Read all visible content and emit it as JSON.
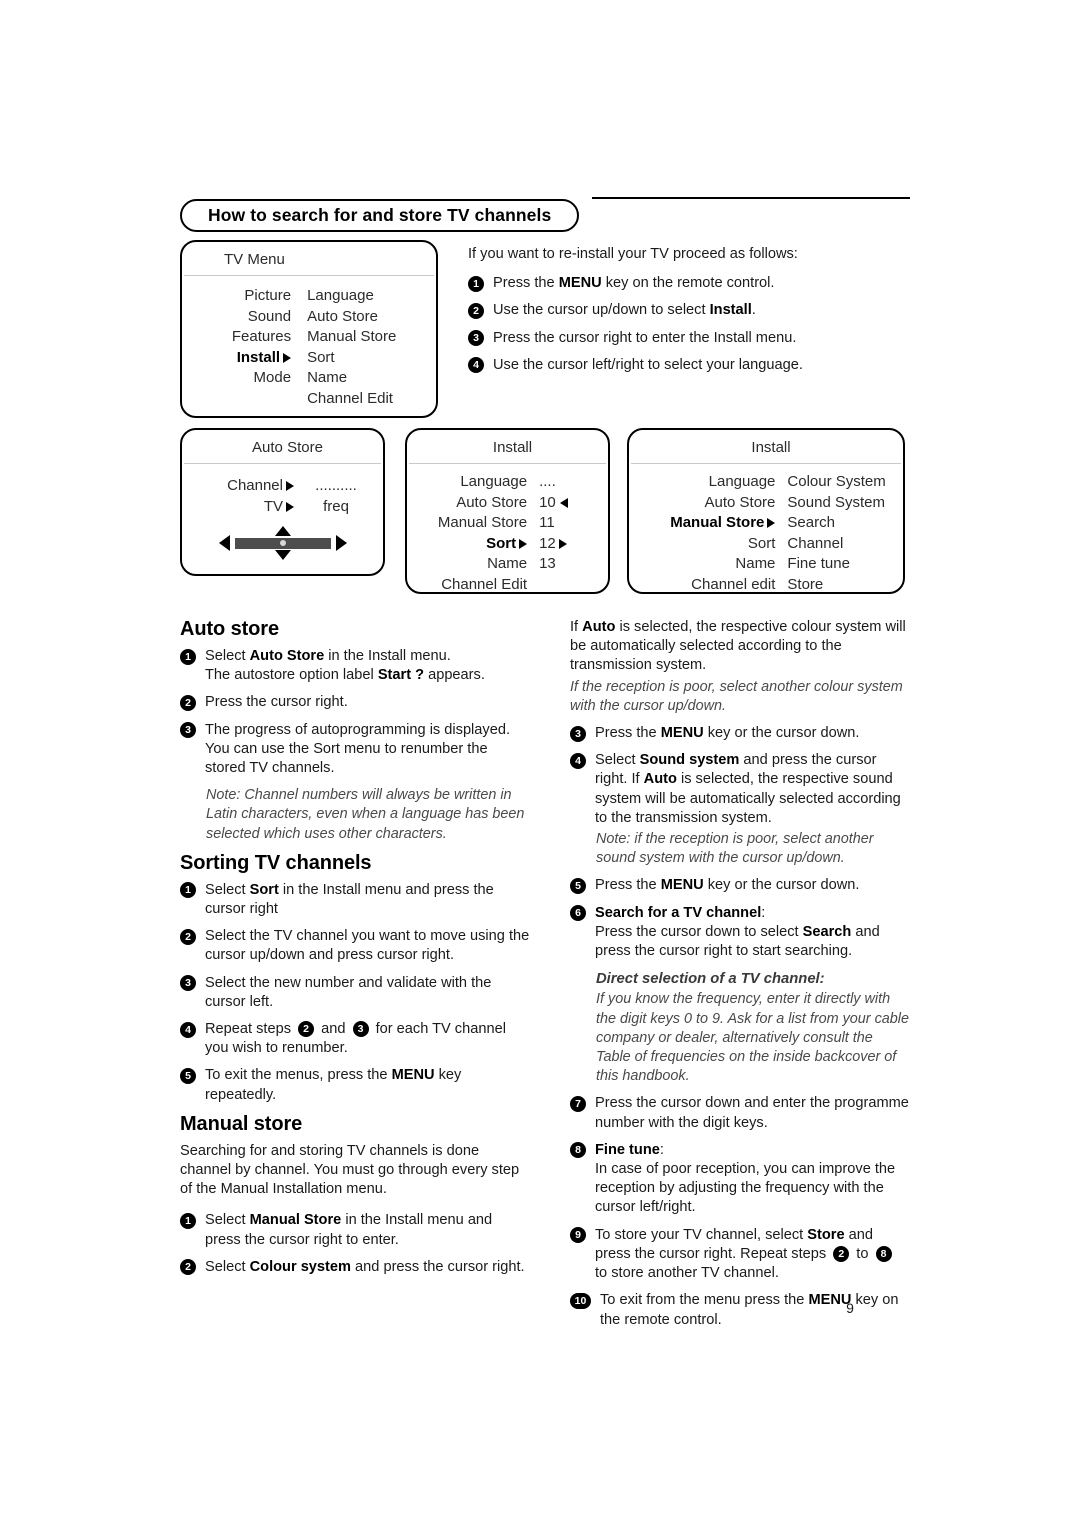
{
  "header": {
    "title": "How to search for and store TV channels"
  },
  "tv_menu_box": {
    "title": "TV Menu",
    "column1": [
      "Picture",
      "Sound",
      "Features",
      "Install",
      "Mode"
    ],
    "column1_selected": "Install",
    "column2": [
      "Language",
      "Auto Store",
      "Manual Store",
      "Sort",
      "Name",
      "Channel Edit"
    ]
  },
  "intro": {
    "lead": "If you want to re-install your TV proceed as follows:",
    "steps": [
      {
        "n": "1",
        "html": "Press the <b>MENU</b> key on the remote control."
      },
      {
        "n": "2",
        "html": "Use the cursor up/down to select <b>Install</b>."
      },
      {
        "n": "3",
        "html": "Press the cursor right to enter the Install menu."
      },
      {
        "n": "4",
        "html": "Use the cursor left/right to select your language."
      }
    ]
  },
  "auto_store_box": {
    "title": "Auto Store",
    "rows": [
      {
        "label": "Channel",
        "arrow": "right",
        "value": ".........."
      },
      {
        "label": "TV",
        "arrow": "right",
        "value": "freq"
      }
    ],
    "slider": {
      "present": true
    }
  },
  "install_box_1": {
    "title": "Install",
    "items": [
      {
        "label": "Language",
        "arrow": "",
        "value": "....",
        "value_arrow": "",
        "bold": false
      },
      {
        "label": "Auto Store",
        "arrow": "",
        "value": "10",
        "value_arrow": "left",
        "bold": false
      },
      {
        "label": "Manual Store",
        "arrow": "",
        "value": "11",
        "value_arrow": "",
        "bold": false
      },
      {
        "label": "Sort",
        "arrow": "right",
        "value": "12",
        "value_arrow": "right",
        "bold": true
      },
      {
        "label": "Name",
        "arrow": "",
        "value": "13",
        "value_arrow": "",
        "bold": false
      },
      {
        "label": "Channel Edit",
        "arrow": "",
        "value": "",
        "value_arrow": "",
        "bold": false
      }
    ]
  },
  "install_box_2": {
    "title": "Install",
    "column1": [
      {
        "label": "Language",
        "arrow": "",
        "bold": false
      },
      {
        "label": "Auto Store",
        "arrow": "",
        "bold": false
      },
      {
        "label": "Manual Store",
        "arrow": "right",
        "bold": true
      },
      {
        "label": "Sort",
        "arrow": "",
        "bold": false
      },
      {
        "label": "Name",
        "arrow": "",
        "bold": false
      },
      {
        "label": "Channel edit",
        "arrow": "",
        "bold": false
      }
    ],
    "column2": [
      "Colour System",
      "Sound System",
      "Search",
      "Channel",
      "Fine tune",
      "Store"
    ]
  },
  "sections": {
    "auto_store": {
      "heading": "Auto store",
      "steps": [
        {
          "n": "1",
          "html": "Select <b>Auto Store</b> in the Install menu.<br>The autostore option label <b>Start ?</b> appears."
        },
        {
          "n": "2",
          "html": "Press the cursor right."
        },
        {
          "n": "3",
          "html": "The progress of autoprogramming is displayed. You can use the Sort menu to renumber the stored TV channels."
        }
      ],
      "note": "Note: Channel numbers will always be written in Latin characters, even when a language has been selected which uses other characters."
    },
    "sorting": {
      "heading": "Sorting TV channels",
      "steps": [
        {
          "n": "1",
          "html": "Select <b>Sort</b> in the Install menu and press the cursor right"
        },
        {
          "n": "2",
          "html": "Select the TV channel you want to move using the cursor up/down and press cursor right."
        },
        {
          "n": "3",
          "html": "Select the new number and validate with the cursor left."
        },
        {
          "n": "4",
          "html": "Repeat steps <span class=\"bul bul-inline\">2</span> and <span class=\"bul bul-inline\">3</span> for each TV channel you wish to renumber."
        },
        {
          "n": "5",
          "html": "To exit the menus, press the <b>MENU</b> key repeatedly."
        }
      ]
    },
    "manual_store": {
      "heading": "Manual store",
      "intro": "Searching for and storing TV channels is done channel by channel. You must go through every step of the Manual Installation menu.",
      "steps": [
        {
          "n": "1",
          "html": "Select <b>Manual Store</b> in the Install menu and press the cursor right to enter."
        },
        {
          "n": "2",
          "html": "Select <b>Colour system</b> and press the cursor right."
        }
      ]
    },
    "right_column": {
      "continuation": "If <b>Auto</b> is selected, the respective colour system will be automatically selected according to the transmission system.",
      "continuation_note": "If the reception is poor, select another colour system with the cursor up/down.",
      "steps": [
        {
          "n": "3",
          "html": "Press the <b>MENU</b> key or the cursor down.",
          "note": ""
        },
        {
          "n": "4",
          "html": "Select <b>Sound system</b> and press the cursor right. If <b>Auto</b> is selected, the respective sound system will be automatically selected according to the transmission system.",
          "note": "Note: if the reception is poor, select another sound system with the cursor up/down."
        },
        {
          "n": "5",
          "html": "Press the <b>MENU</b> key or the cursor down.",
          "note": ""
        },
        {
          "n": "6",
          "html": "<b>Search for a TV channel</b>:<br>Press the cursor down to select <b>Search</b> and press the cursor right to start searching.",
          "note": ""
        }
      ],
      "direct_selection_heading": "Direct selection of a TV channel:",
      "direct_selection_note": "If you know the frequency, enter it directly with the digit keys 0 to 9. Ask for a list from your cable company or dealer, alternatively consult the Table of frequencies on the inside backcover of this handbook.",
      "steps2": [
        {
          "n": "7",
          "html": "Press the cursor down and enter the programme number with the digit keys."
        },
        {
          "n": "8",
          "html": "<b>Fine tune</b>:<br>In case of poor reception, you can improve the reception by adjusting the frequency with the cursor left/right."
        },
        {
          "n": "9",
          "html": "To store your TV channel, select <b>Store</b> and press the cursor right. Repeat steps <span class=\"bul bul-inline\">2</span> to <span class=\"bul bul-inline\">8</span> to store another TV channel."
        },
        {
          "n": "10",
          "html": "To exit from the menu press the <b>MENU</b> key on the remote control.",
          "wide": true
        }
      ]
    }
  },
  "footer": {
    "page_number": "9"
  }
}
